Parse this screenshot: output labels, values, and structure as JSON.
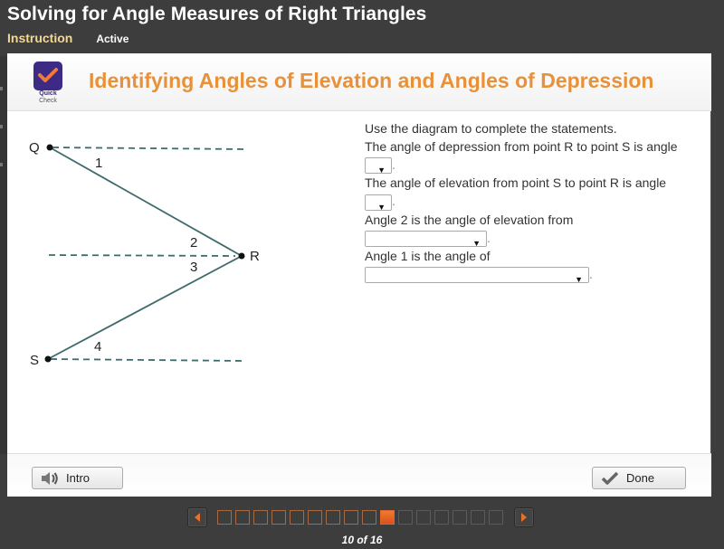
{
  "app": {
    "title": "Solving for Angle Measures of Right Triangles",
    "tabs": [
      {
        "label": "Instruction",
        "state": "selected"
      },
      {
        "label": "Active",
        "state": "status"
      }
    ]
  },
  "card": {
    "logo": {
      "icon": "checkmark-icon",
      "line1": "Quick",
      "line2": "Check"
    },
    "heading": "Identifying Angles of Elevation and Angles of Depression",
    "diagram": {
      "points": [
        "Q",
        "R",
        "S"
      ],
      "angle_labels": [
        "1",
        "2",
        "3",
        "4"
      ]
    },
    "question": {
      "intro": "Use the diagram to complete the statements.",
      "statements": [
        {
          "text_before": "The angle of depression from point R to point S is angle",
          "selected": ""
        },
        {
          "text_before": "The angle of elevation from point S to point R is angle",
          "selected": ""
        },
        {
          "text_before": "Angle 2 is the angle of elevation from",
          "selected": ""
        },
        {
          "text_before": "Angle 1 is the angle of",
          "selected": ""
        }
      ],
      "dropdown_arrow": "▼",
      "terminator": "."
    },
    "footer": {
      "intro_button": {
        "label": "Intro",
        "icon": "speaker-icon"
      },
      "done_button": {
        "label": "Done",
        "icon": "checkmark-icon"
      }
    }
  },
  "pager": {
    "current": 10,
    "total": 16,
    "label": "10 of 16",
    "prev_icon": "left-triangle-icon",
    "next_icon": "right-triangle-icon"
  },
  "colors": {
    "accent_orange": "#e8913a",
    "instruction_tab": "#f0d896",
    "logo_purple": "#3c2a85",
    "diagram_line": "#3e6b6b"
  }
}
